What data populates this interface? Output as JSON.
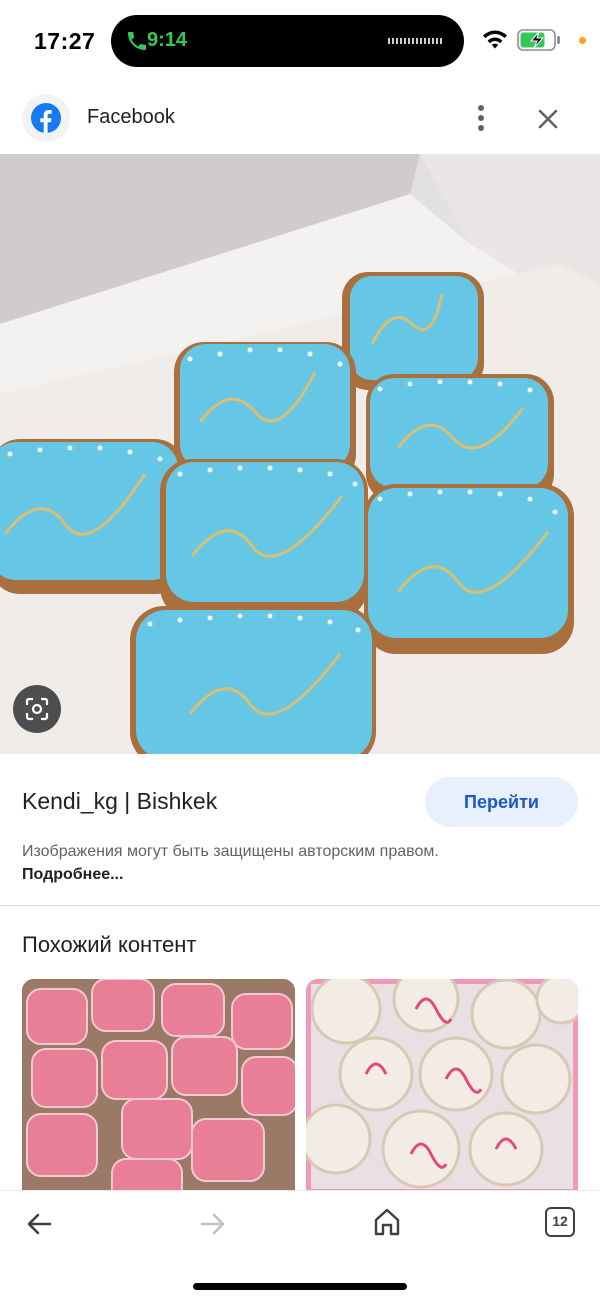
{
  "status_bar": {
    "time": "17:27",
    "call_time": "9:14",
    "icons": [
      "phone-icon",
      "wifi-icon",
      "battery-charging-icon"
    ],
    "accent_call": "#34c759"
  },
  "header": {
    "source_name": "Facebook",
    "icons": [
      "facebook-logo",
      "more-vert-icon",
      "close-icon"
    ]
  },
  "main_image": {
    "description_icon": "lens-icon"
  },
  "info": {
    "source_title": "Kendi_kg | Bishkek",
    "go_button": "Перейти",
    "copyright_text": "Изображения могут быть защищены авторским правом.",
    "more_link": "Подробнее..."
  },
  "similar": {
    "title": "Похожий контент"
  },
  "toolbar": {
    "tab_count": "12",
    "icons": [
      "back-arrow-icon",
      "forward-arrow-icon",
      "home-icon",
      "tabs-icon"
    ]
  },
  "colors": {
    "button_bg": "#e8f0fe",
    "button_text": "#1a57c8",
    "cookie_icing": "#66c6e6"
  }
}
